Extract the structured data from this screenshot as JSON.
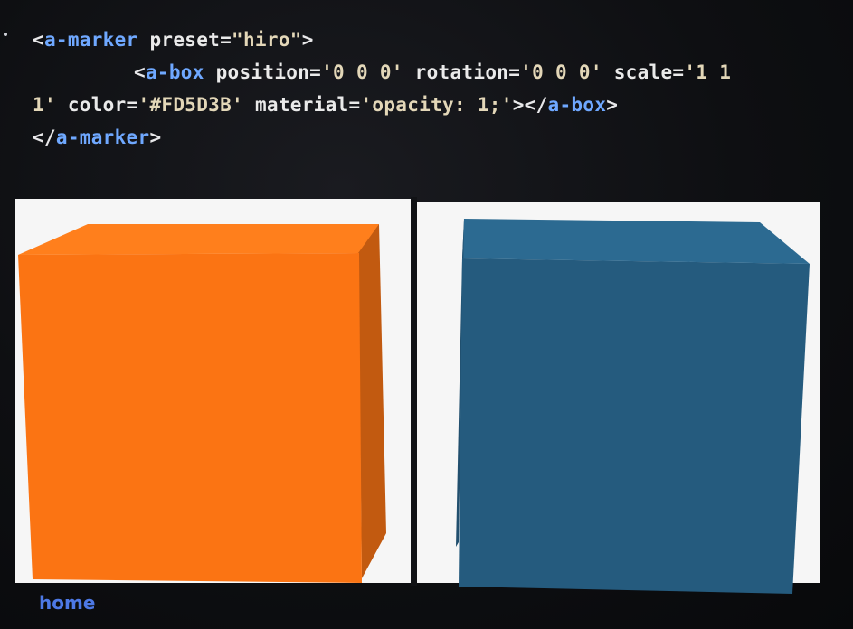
{
  "code": {
    "line1": {
      "open": "<",
      "tag": "a-marker",
      "attr": " preset=",
      "val": "\"hiro\"",
      "close": ">"
    },
    "line2": {
      "open": "<",
      "tag": "a-box",
      "a1": " position=",
      "v1": "'0 0 0'",
      "a2": " rotation=",
      "v2": "'0 0 0'",
      "a3": " scale=",
      "v3a": "'1 1"
    },
    "line3": {
      "v3b": "1'",
      "a4": " color=",
      "v4": "'#FD5D3B'",
      "a5": " material=",
      "v5": "'opacity: 1;'",
      "mid": "></",
      "tag": "a-box",
      "close": ">"
    },
    "line4": {
      "open": "</",
      "tag": "a-marker",
      "close": ">"
    }
  },
  "colors": {
    "orange_front": "#fb7413",
    "orange_top": "#ff7f1c",
    "orange_side": "#c25a10",
    "blue_front": "#255b7e",
    "blue_top": "#2c6a91",
    "blue_side": "#214f6e"
  },
  "footer": {
    "home_label": "home"
  }
}
